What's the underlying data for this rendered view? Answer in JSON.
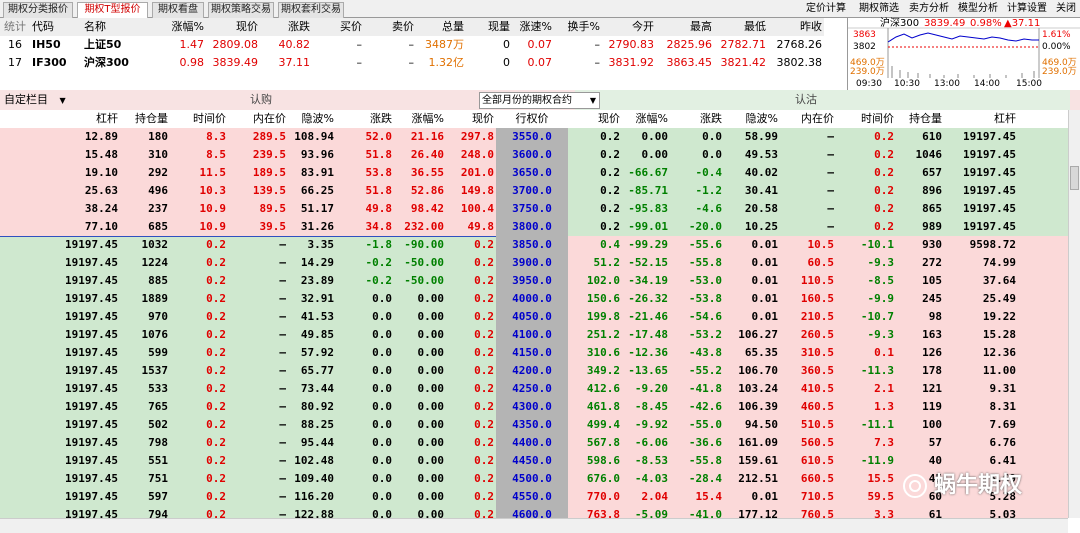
{
  "tabs": [
    "期权分类报价",
    "期权T型报价",
    "期权看盘",
    "期权策略交易",
    "期权套利交易"
  ],
  "menu": [
    "定价计算",
    "期权筛选",
    "卖方分析",
    "模型分析",
    "计算设置",
    "关闭"
  ],
  "quote_headers": [
    "统计",
    "代码",
    "名称",
    "涨幅%",
    "现价",
    "涨跌",
    "买价",
    "卖价",
    "总量",
    "现量",
    "涨速%",
    "换手%",
    "今开",
    "最高",
    "最低",
    "昨收"
  ],
  "quote_rows": [
    [
      "16",
      "IH50",
      "上证50",
      "1.47",
      "2809.08",
      "40.82",
      "–",
      "–",
      "3487万",
      "0",
      "0.07",
      "–",
      "2790.83",
      "2825.96",
      "2782.71",
      "2768.26"
    ],
    [
      "17",
      "IF300",
      "沪深300",
      "0.98",
      "3839.49",
      "37.11",
      "–",
      "–",
      "1.32亿",
      "0",
      "0.07",
      "–",
      "3831.92",
      "3863.45",
      "3821.42",
      "3802.38"
    ]
  ],
  "mini_chart": {
    "name": "沪深300",
    "price": "3839.49",
    "pct": "0.98%",
    "chg": "▲37.11",
    "y_top": "3863",
    "y_mid": "3802",
    "y_low1": "469.0万",
    "y_low2": "239.0万",
    "right_top": "1.61%",
    "right_mid": "0.00%",
    "times": [
      "09:30",
      "10:30",
      "13:00",
      "14:00",
      "15:00"
    ],
    "line_color": "#0000cc"
  },
  "controls": {
    "custom": "自定栏目",
    "call_label": "认购",
    "month_select": "全部月份的期权合约",
    "put_label": "认沽"
  },
  "t_headers": [
    "杠杆",
    "持仓量",
    "时间价",
    "内在价",
    "隐波%",
    "涨跌",
    "涨幅%",
    "现价",
    "行权价",
    "现价",
    "涨幅%",
    "涨跌",
    "隐波%",
    "内在价",
    "时间价",
    "持仓量",
    "杠杆"
  ],
  "t_rows": [
    [
      "12.89",
      "180",
      "8.3",
      "289.5",
      "108.94",
      "52.0",
      "21.16",
      "297.8",
      "3550.0",
      "0.2",
      "0.00",
      "0.0",
      "58.99",
      "–",
      "0.2",
      "610",
      "19197.45"
    ],
    [
      "15.48",
      "310",
      "8.5",
      "239.5",
      "93.96",
      "51.8",
      "26.40",
      "248.0",
      "3600.0",
      "0.2",
      "0.00",
      "0.0",
      "49.53",
      "–",
      "0.2",
      "1046",
      "19197.45"
    ],
    [
      "19.10",
      "292",
      "11.5",
      "189.5",
      "83.91",
      "53.8",
      "36.55",
      "201.0",
      "3650.0",
      "0.2",
      "-66.67",
      "-0.4",
      "40.02",
      "–",
      "0.2",
      "657",
      "19197.45"
    ],
    [
      "25.63",
      "496",
      "10.3",
      "139.5",
      "66.25",
      "51.8",
      "52.86",
      "149.8",
      "3700.0",
      "0.2",
      "-85.71",
      "-1.2",
      "30.41",
      "–",
      "0.2",
      "896",
      "19197.45"
    ],
    [
      "38.24",
      "237",
      "10.9",
      "89.5",
      "51.17",
      "49.8",
      "98.42",
      "100.4",
      "3750.0",
      "0.2",
      "-95.83",
      "-4.6",
      "20.58",
      "–",
      "0.2",
      "865",
      "19197.45"
    ],
    [
      "77.10",
      "685",
      "10.9",
      "39.5",
      "31.26",
      "34.8",
      "232.00",
      "49.8",
      "3800.0",
      "0.2",
      "-99.01",
      "-20.0",
      "10.25",
      "–",
      "0.2",
      "989",
      "19197.45"
    ],
    [
      "19197.45",
      "1032",
      "0.2",
      "–",
      "3.35",
      "-1.8",
      "-90.00",
      "0.2",
      "3850.0",
      "0.4",
      "-99.29",
      "-55.6",
      "0.01",
      "10.5",
      "-10.1",
      "930",
      "9598.72"
    ],
    [
      "19197.45",
      "1224",
      "0.2",
      "–",
      "14.29",
      "-0.2",
      "-50.00",
      "0.2",
      "3900.0",
      "51.2",
      "-52.15",
      "-55.8",
      "0.01",
      "60.5",
      "-9.3",
      "272",
      "74.99"
    ],
    [
      "19197.45",
      "885",
      "0.2",
      "–",
      "23.89",
      "-0.2",
      "-50.00",
      "0.2",
      "3950.0",
      "102.0",
      "-34.19",
      "-53.0",
      "0.01",
      "110.5",
      "-8.5",
      "105",
      "37.64"
    ],
    [
      "19197.45",
      "1889",
      "0.2",
      "–",
      "32.91",
      "0.0",
      "0.00",
      "0.2",
      "4000.0",
      "150.6",
      "-26.32",
      "-53.8",
      "0.01",
      "160.5",
      "-9.9",
      "245",
      "25.49"
    ],
    [
      "19197.45",
      "970",
      "0.2",
      "–",
      "41.53",
      "0.0",
      "0.00",
      "0.2",
      "4050.0",
      "199.8",
      "-21.46",
      "-54.6",
      "0.01",
      "210.5",
      "-10.7",
      "98",
      "19.22"
    ],
    [
      "19197.45",
      "1076",
      "0.2",
      "–",
      "49.85",
      "0.0",
      "0.00",
      "0.2",
      "4100.0",
      "251.2",
      "-17.48",
      "-53.2",
      "106.27",
      "260.5",
      "-9.3",
      "163",
      "15.28"
    ],
    [
      "19197.45",
      "599",
      "0.2",
      "–",
      "57.92",
      "0.0",
      "0.00",
      "0.2",
      "4150.0",
      "310.6",
      "-12.36",
      "-43.8",
      "65.35",
      "310.5",
      "0.1",
      "126",
      "12.36"
    ],
    [
      "19197.45",
      "1537",
      "0.2",
      "–",
      "65.77",
      "0.0",
      "0.00",
      "0.2",
      "4200.0",
      "349.2",
      "-13.65",
      "-55.2",
      "106.70",
      "360.5",
      "-11.3",
      "178",
      "11.00"
    ],
    [
      "19197.45",
      "533",
      "0.2",
      "–",
      "73.44",
      "0.0",
      "0.00",
      "0.2",
      "4250.0",
      "412.6",
      "-9.20",
      "-41.8",
      "103.24",
      "410.5",
      "2.1",
      "121",
      "9.31"
    ],
    [
      "19197.45",
      "765",
      "0.2",
      "–",
      "80.92",
      "0.0",
      "0.00",
      "0.2",
      "4300.0",
      "461.8",
      "-8.45",
      "-42.6",
      "106.39",
      "460.5",
      "1.3",
      "119",
      "8.31"
    ],
    [
      "19197.45",
      "502",
      "0.2",
      "–",
      "88.25",
      "0.0",
      "0.00",
      "0.2",
      "4350.0",
      "499.4",
      "-9.92",
      "-55.0",
      "94.50",
      "510.5",
      "-11.1",
      "100",
      "7.69"
    ],
    [
      "19197.45",
      "798",
      "0.2",
      "–",
      "95.44",
      "0.0",
      "0.00",
      "0.2",
      "4400.0",
      "567.8",
      "-6.06",
      "-36.6",
      "161.09",
      "560.5",
      "7.3",
      "57",
      "6.76"
    ],
    [
      "19197.45",
      "551",
      "0.2",
      "–",
      "102.48",
      "0.0",
      "0.00",
      "0.2",
      "4450.0",
      "598.6",
      "-8.53",
      "-55.8",
      "159.61",
      "610.5",
      "-11.9",
      "40",
      "6.41"
    ],
    [
      "19197.45",
      "751",
      "0.2",
      "–",
      "109.40",
      "0.0",
      "0.00",
      "0.2",
      "4500.0",
      "676.0",
      "-4.03",
      "-28.4",
      "212.51",
      "660.5",
      "15.5",
      "45",
      "5.69"
    ],
    [
      "19197.45",
      "597",
      "0.2",
      "–",
      "116.20",
      "0.0",
      "0.00",
      "0.2",
      "4550.0",
      "770.0",
      "2.04",
      "15.4",
      "0.01",
      "710.5",
      "59.5",
      "60",
      "5.28"
    ],
    [
      "19197.45",
      "794",
      "0.2",
      "–",
      "122.88",
      "0.0",
      "0.00",
      "0.2",
      "4600.0",
      "763.8",
      "-5.09",
      "-41.0",
      "177.12",
      "760.5",
      "3.3",
      "61",
      "5.03"
    ]
  ],
  "watermark": "蜗牛期权",
  "colors": {
    "call_itm": "#fbd9d9",
    "put_itm": "#cfe8cf",
    "strike_col": "#b4b4b4",
    "up": "#e00000",
    "down": "#008000"
  }
}
